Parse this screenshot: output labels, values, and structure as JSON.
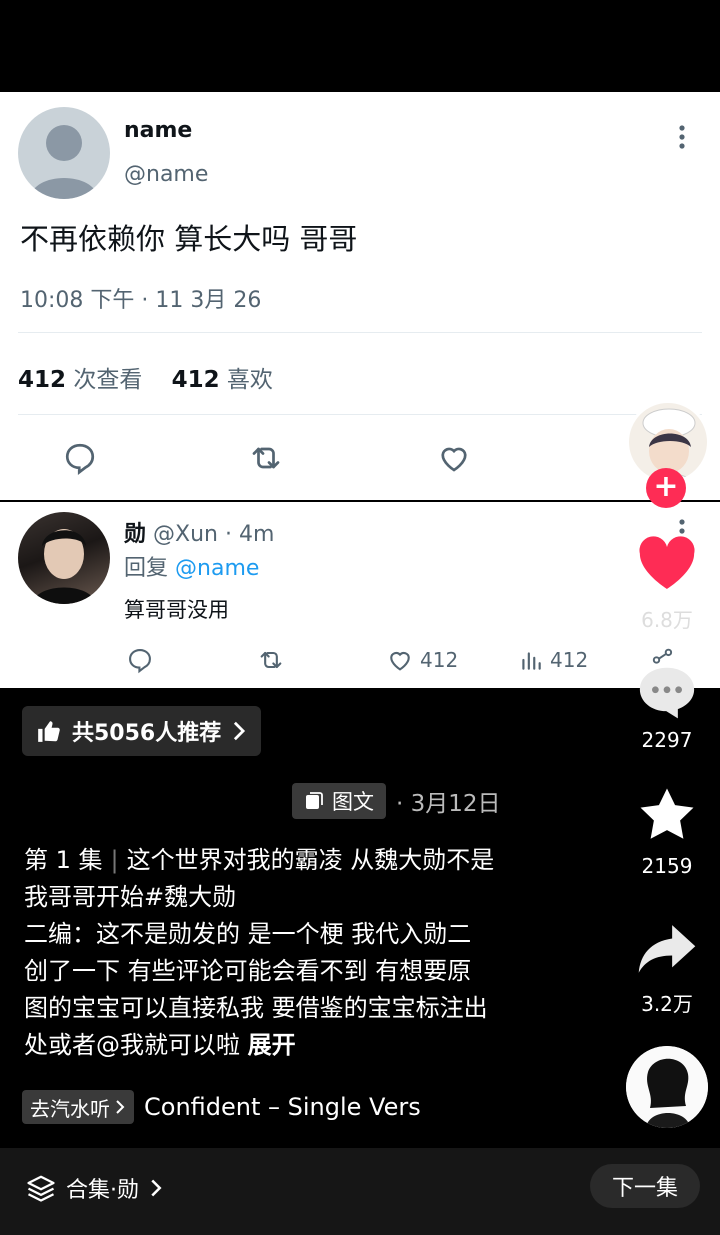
{
  "tweet": {
    "name": "name",
    "handle": "@name",
    "text": "不再依赖你 算长大吗 哥哥",
    "meta": "10:08 下午 · 11 3月 26",
    "views_count": "412",
    "views_label": "次查看",
    "likes_count": "412",
    "likes_label": "喜欢"
  },
  "reply": {
    "name": "勋",
    "handle": "@Xun · 4m",
    "reply_prefix": "回复",
    "reply_to": "@name",
    "text": "算哥哥没用",
    "likes": "412",
    "views": "412"
  },
  "rail": {
    "like_count": "6.8万",
    "comment_count": "2297",
    "favorite_count": "2159",
    "share_count": "3.2万",
    "like_color": "#fe2c55"
  },
  "recommend": {
    "label": "共5056人推荐"
  },
  "post": {
    "tag_label": "图文",
    "date": "· 3月12日",
    "episode": "第 1 集",
    "line1": "这个世界对我的霸凌 从魏大勋不是",
    "line2": "我哥哥开始#魏大勋",
    "line3": "二编：这不是勋发的 是一个梗 我代入勋二",
    "line4": "创了一下 有些评论可能会看不到 有想要原",
    "line5": "图的宝宝可以直接私我 要借鉴的宝宝标注出",
    "line6": "处或者@我就可以啦",
    "expand": "展开"
  },
  "music": {
    "button": "去汽水听",
    "song": "Confident – Single Vers"
  },
  "bottom": {
    "collection": "合集·勋",
    "next": "下一集"
  }
}
